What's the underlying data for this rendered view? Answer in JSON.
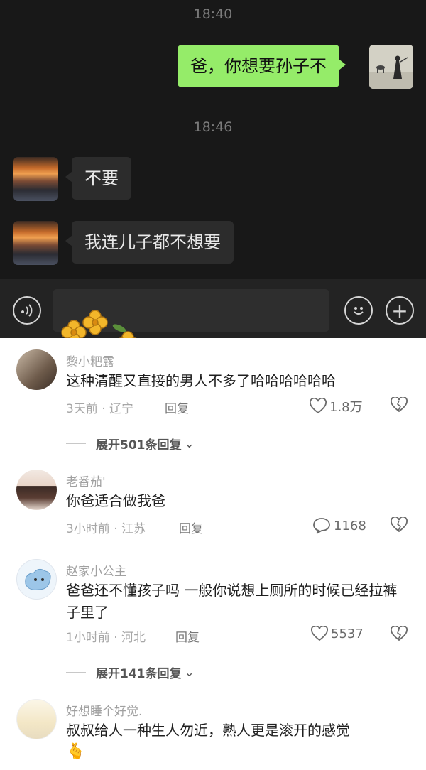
{
  "chat": {
    "time1": "18:40",
    "sent_message": "爸，你想要孙子不",
    "time2": "18:46",
    "reply1": "不要",
    "reply2": "我连儿子都不想要"
  },
  "comments": [
    {
      "user": "黎小粑露",
      "text": "这种清醒又直接的男人不多了哈哈哈哈哈哈",
      "meta": "3天前 · 辽宁",
      "reply_label": "回复",
      "likes": "1.8万",
      "expand": "展开501条回复"
    },
    {
      "user": "老番茄'",
      "text": "你爸适合做我爸",
      "meta": "3小时前 · 江苏",
      "reply_label": "回复",
      "likes": "1168"
    },
    {
      "user": "赵家小公主",
      "text": "爸爸还不懂孩子吗 一般你说想上厕所的时候已经拉裤子里了",
      "meta": "1小时前 · 河北",
      "reply_label": "回复",
      "likes": "5537",
      "expand": "展开141条回复"
    },
    {
      "user": "好想睡个好觉.",
      "text": "叔叔给人一种生人勿近，熟人更是滚开的感觉",
      "emoji": "🫰"
    }
  ],
  "icons": {
    "voice": "voice-icon",
    "emoji": "emoji-icon",
    "add": "plus-icon",
    "like": "heart-icon",
    "dislike": "broken-heart-icon"
  },
  "colors": {
    "sent_bubble": "#95ec69",
    "chat_bg": "#181818",
    "received_bubble": "#2c2c2c"
  }
}
